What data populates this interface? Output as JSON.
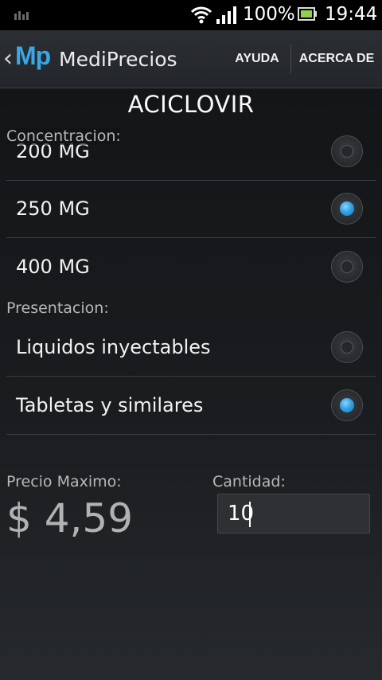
{
  "status_bar": {
    "battery_percent": "100%",
    "time": "19:44",
    "icons": [
      "notification-icon",
      "wifi-icon",
      "signal-icon",
      "battery-icon"
    ]
  },
  "action_bar": {
    "logo": "Mp",
    "title": "MediPrecios",
    "actions": [
      "AYUDA",
      "ACERCA DE"
    ]
  },
  "drug_name": "ACICLOVIR",
  "concentracion": {
    "label": "Concentracion:",
    "options": [
      {
        "label": "200 MG",
        "selected": false
      },
      {
        "label": "250 MG",
        "selected": true
      },
      {
        "label": "400 MG",
        "selected": false
      }
    ]
  },
  "presentacion": {
    "label": "Presentacion:",
    "options": [
      {
        "label": "Liquidos inyectables",
        "selected": false
      },
      {
        "label": "Tabletas y similares",
        "selected": true
      }
    ]
  },
  "precio": {
    "label": "Precio Maximo:",
    "value": "$ 4,59"
  },
  "cantidad": {
    "label": "Cantidad:",
    "value": "10"
  },
  "colors": {
    "accent": "#39a6e6",
    "background": "#16181b",
    "action_bar": "#2a2d31"
  }
}
